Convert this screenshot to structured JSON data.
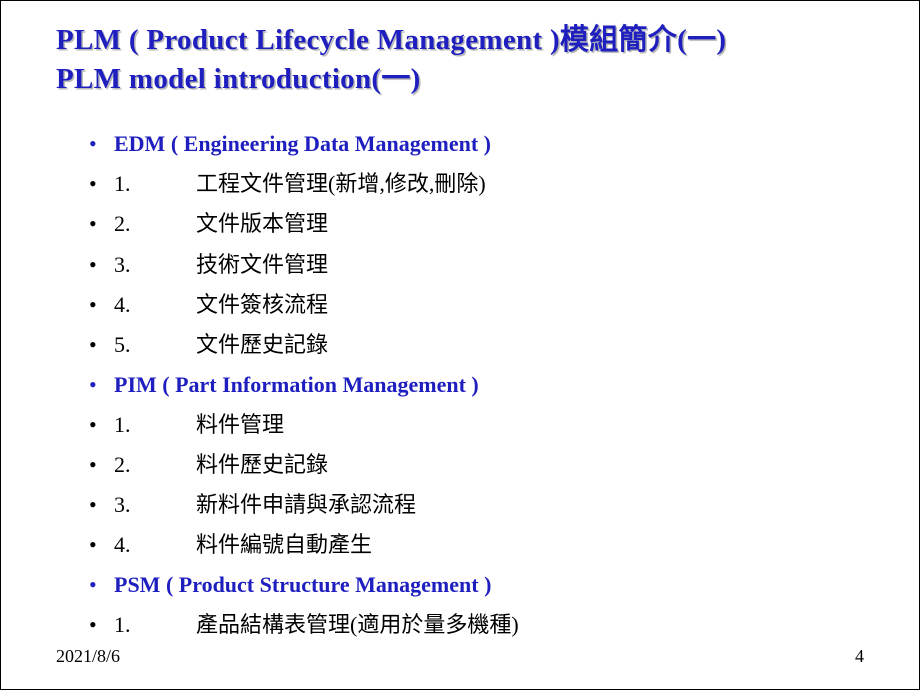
{
  "title": {
    "line1": "PLM ( Product Lifecycle Management )模組簡介(一)",
    "line2": "PLM model introduction(一)"
  },
  "sections": [
    {
      "heading": "EDM ( Engineering Data Management )",
      "items": [
        {
          "num": "1.",
          "text": "工程文件管理(新增,修改,刪除)"
        },
        {
          "num": "2.",
          "text": "文件版本管理"
        },
        {
          "num": "3.",
          "text": "技術文件管理"
        },
        {
          "num": "4.",
          "text": "文件簽核流程"
        },
        {
          "num": "5.",
          "text": "文件歷史記錄"
        }
      ]
    },
    {
      "heading": "PIM ( Part Information Management )",
      "items": [
        {
          "num": "1.",
          "text": "料件管理"
        },
        {
          "num": "2.",
          "text": "料件歷史記錄"
        },
        {
          "num": "3.",
          "text": "新料件申請與承認流程"
        },
        {
          "num": "4.",
          "text": "料件編號自動產生"
        }
      ]
    },
    {
      "heading": "PSM ( Product Structure Management )",
      "items": [
        {
          "num": "1.",
          "text": "產品結構表管理(適用於量多機種)"
        }
      ]
    }
  ],
  "footer": {
    "date": "2021/8/6",
    "page": "4"
  }
}
